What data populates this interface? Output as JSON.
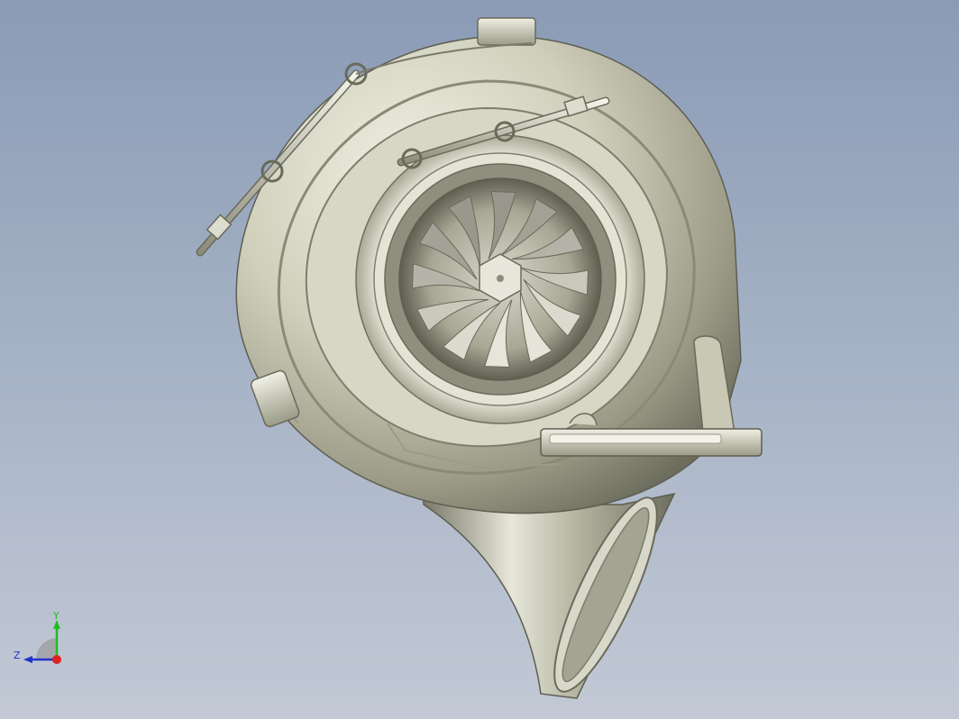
{
  "viewport": {
    "background_top": "#8a9bb6",
    "background_bottom": "#c2c9d5"
  },
  "model": {
    "name_icon": "turbocharger-model",
    "metal_color": "#c9c9b4"
  },
  "triad": {
    "y_label": "Y",
    "z_label": "Z",
    "y_color": "#22bb22",
    "z_color": "#2233cc",
    "x_color": "#dd2222"
  }
}
